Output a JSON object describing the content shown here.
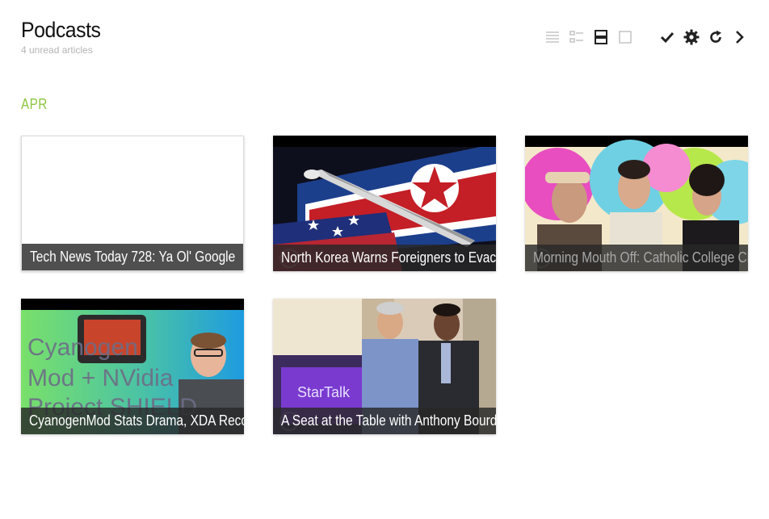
{
  "header": {
    "title": "Podcasts",
    "subtitle": "4 unread articles"
  },
  "toolbar": {
    "icons": [
      "list-view-icon",
      "compact-view-icon",
      "cards-view-icon",
      "full-view-icon",
      "mark-read-icon",
      "settings-icon",
      "refresh-icon",
      "next-icon"
    ]
  },
  "section": {
    "label": "APR"
  },
  "articles": [
    {
      "title": "Tech News Today 728: Ya Ol' Google",
      "thumbnail": "blank"
    },
    {
      "title": "North Korea Warns Foreigners to Evacuate",
      "thumbnail": "north-korea-missile-flags"
    },
    {
      "title": "Morning Mouth Off: Catholic College Claims",
      "thumbnail": "three-people-laughing"
    },
    {
      "title": "CyanogenMod Stats Drama, XDA Recognized",
      "thumbnail": "cyanogenmod-nvidia-shield",
      "image_text": "Cyanogen Mod + NVidia Project SHIELD"
    },
    {
      "title": "A Seat at the Table with Anthony Bourdain",
      "thumbnail": "two-men-startalk",
      "image_text": "StarTalk"
    }
  ],
  "colors": {
    "accent": "#8dc63f",
    "caption_bg": "#282828",
    "active_icon": "#222222",
    "inactive_icon": "#c4c4c4"
  }
}
